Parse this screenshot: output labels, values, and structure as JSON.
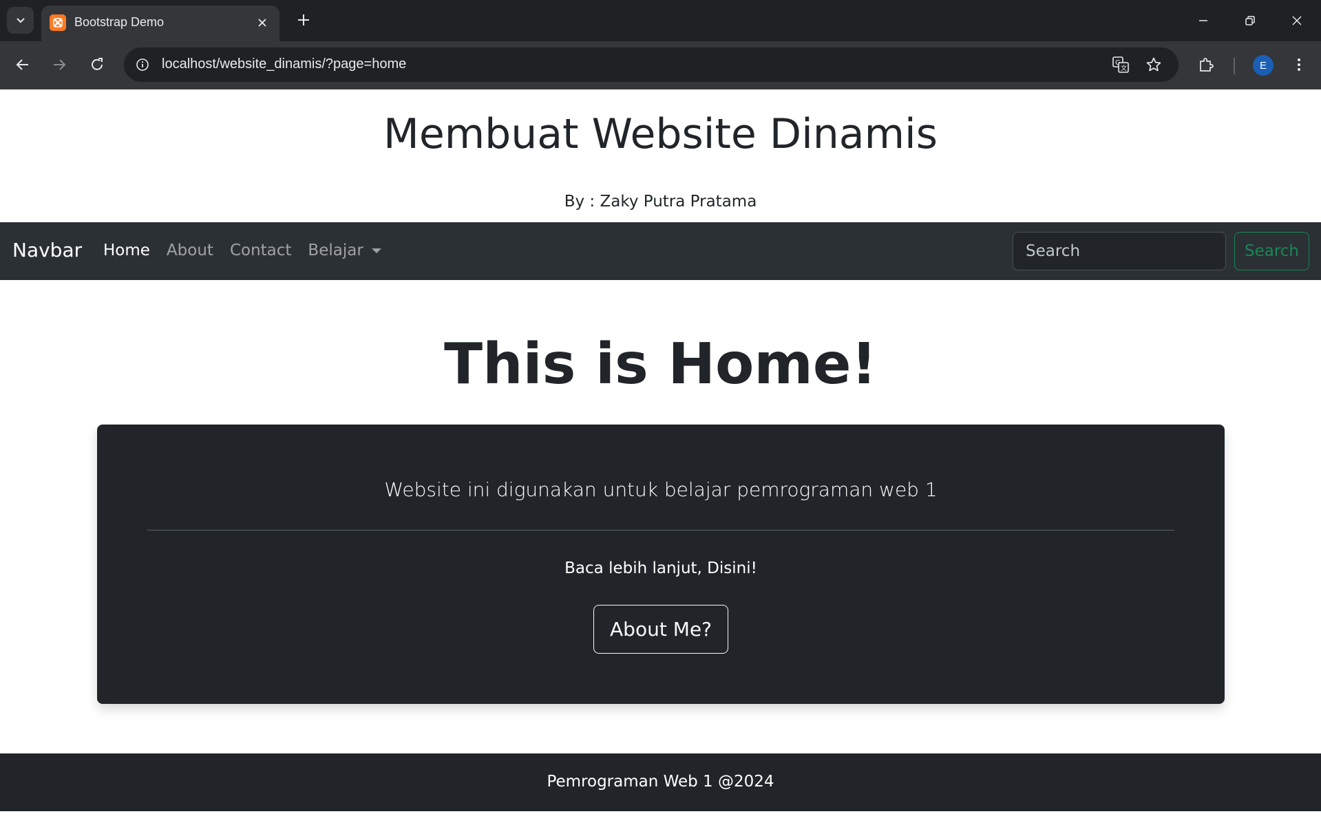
{
  "browser": {
    "tab_title": "Bootstrap Demo",
    "url": "localhost/website_dinamis/?page=home",
    "profile_initial": "E",
    "icons": [
      "tab-search-icon",
      "xampp-favicon-icon",
      "close-icon",
      "plus-icon",
      "minimize-icon",
      "restore-icon",
      "window-close-icon",
      "back-icon",
      "forward-icon",
      "reload-icon",
      "site-info-icon",
      "translate-icon",
      "star-icon",
      "extensions-icon",
      "menu-icon"
    ]
  },
  "header": {
    "title": "Membuat Website Dinamis",
    "author": "By : Zaky Putra Pratama"
  },
  "navbar": {
    "brand": "Navbar",
    "links": [
      {
        "label": "Home",
        "active": true
      },
      {
        "label": "About",
        "active": false
      },
      {
        "label": "Contact",
        "active": false
      },
      {
        "label": "Belajar",
        "active": false,
        "dropdown": true
      }
    ],
    "search_placeholder": "Search",
    "search_button": "Search"
  },
  "main": {
    "heading": "This is Home!",
    "jumbotron": {
      "lead": "Website ini digunakan untuk belajar pemrograman web 1",
      "text": "Baca lebih lanjut, Disini!",
      "button": "About Me?"
    }
  },
  "footer": {
    "text": "Pemrograman Web 1 @2024"
  },
  "colors": {
    "navbar_bg": "#2b3035",
    "jumbotron_bg": "#212529",
    "success": "#198754"
  }
}
